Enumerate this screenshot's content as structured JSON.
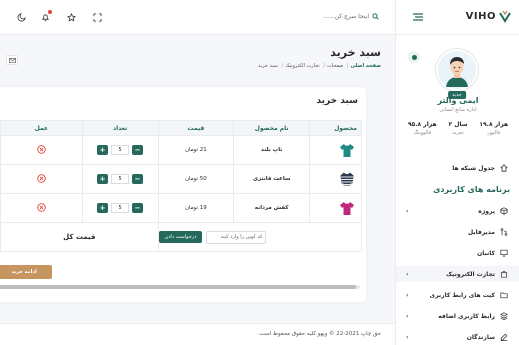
{
  "brand": {
    "name": "VIHO",
    "color": "#24695c"
  },
  "search": {
    "placeholder": "اینجا سرچ کن......"
  },
  "profile": {
    "badge": "جدید",
    "name": "ایمی والتر",
    "role": "اداره منابع انسانی",
    "stats": [
      {
        "value": "۱۹.۸ هزار",
        "label": "فالوور"
      },
      {
        "value": "۲ سال",
        "label": "تجربه"
      },
      {
        "value": "۹۵.۸ هزار",
        "label": "فالووینگ"
      }
    ]
  },
  "nav": {
    "dashboard": "جدول شبکه ها",
    "heading": "برنامه های کاربردی",
    "items": [
      {
        "label": "پروژه",
        "icon": "box-icon",
        "has_arrow": true
      },
      {
        "label": "مدیرفایل",
        "icon": "git-pull-icon",
        "has_arrow": false
      },
      {
        "label": "کانبان",
        "icon": "monitor-icon",
        "has_arrow": false
      },
      {
        "label": "تجارت الکترونیک",
        "icon": "shopping-bag-icon",
        "has_arrow": true
      },
      {
        "label": "کیت های رابط کاربری",
        "icon": "folder-icon",
        "has_arrow": true
      },
      {
        "label": "رابط کاربری اضافه",
        "icon": "layers-icon",
        "has_arrow": true
      },
      {
        "label": "سازندگان",
        "icon": "edit-icon",
        "has_arrow": true
      }
    ]
  },
  "page": {
    "title": "سبد خرید",
    "breadcrumb": [
      "صفحه اصلی",
      "صفحات",
      "تجارت الکترونیک",
      "سبد خرید"
    ]
  },
  "cart": {
    "title": "سبد خرید",
    "columns": [
      "محصول",
      "نام محصول",
      "قیمت",
      "تعداد",
      "عمل"
    ],
    "rows": [
      {
        "name": "تاپ بلند",
        "price": "21 تومان",
        "qty": "5",
        "image": "tshirt-teal"
      },
      {
        "name": "ساعت فانتزی",
        "price": "50 تومان",
        "qty": "5",
        "image": "sweater-striped"
      },
      {
        "name": "کفش مردانه",
        "price": "19 تومان",
        "qty": "5",
        "image": "tshirt-magenta"
      }
    ],
    "coupon_placeholder": "کد کوپن را وارد کنید",
    "coupon_button": "درخواست دادن",
    "total_label": "قیمت کل",
    "continue_button": "ادامه خرید"
  },
  "footer": {
    "text": "حق چاپ 2021-22 © ویهو کلیه حقوق محفوظ است."
  },
  "colors": {
    "accent": "#24695c",
    "danger": "#e2453b",
    "secondary": "#c7955f"
  }
}
